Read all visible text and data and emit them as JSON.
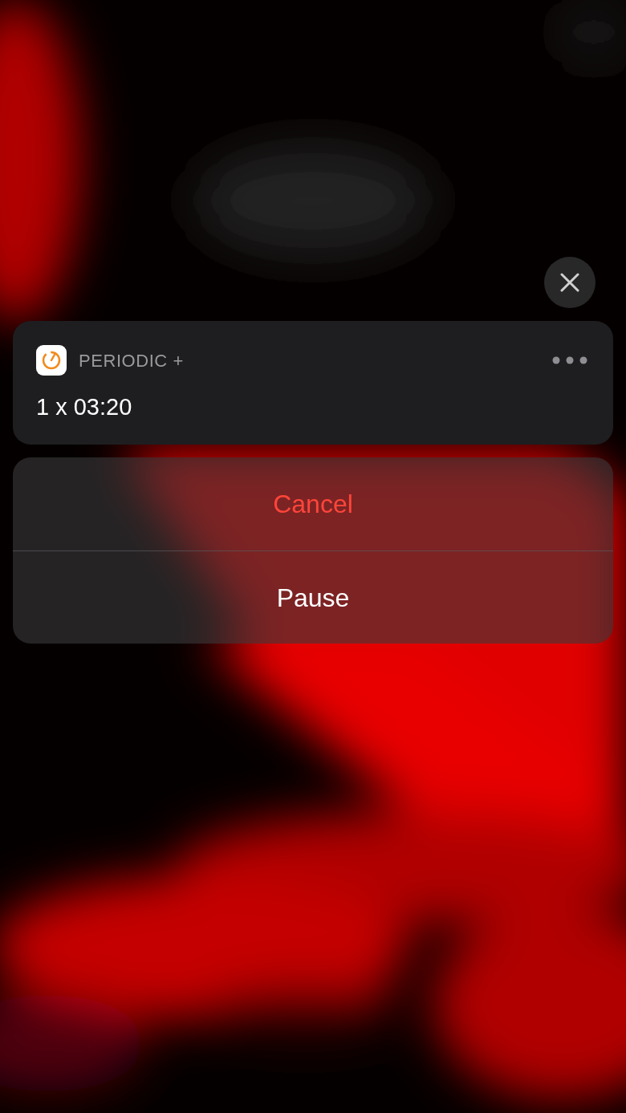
{
  "notification": {
    "app_name": "PERIODIC +",
    "message": "1 x 03:20"
  },
  "actions": [
    {
      "label": "Cancel",
      "kind": "destructive"
    },
    {
      "label": "Pause",
      "kind": "default"
    }
  ]
}
